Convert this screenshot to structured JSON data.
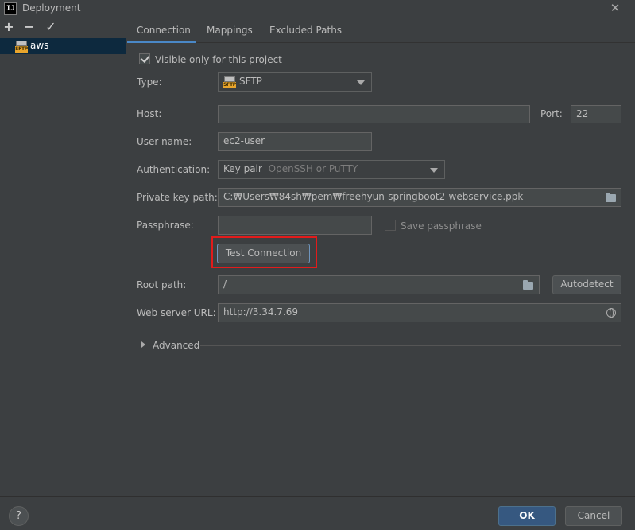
{
  "window": {
    "title": "Deployment",
    "logo_text": "IJ",
    "close_symbol": "✕"
  },
  "toolbar": {
    "add_symbol": "+",
    "remove_symbol": "−",
    "check_symbol": "✓"
  },
  "servers": [
    {
      "name": "aws",
      "icon": "sftp-server-icon",
      "icon_text": "SFTP"
    }
  ],
  "tabs": [
    {
      "label": "Connection",
      "active": true
    },
    {
      "label": "Mappings",
      "active": false
    },
    {
      "label": "Excluded Paths",
      "active": false
    }
  ],
  "form": {
    "visible_only_label": "Visible only for this project",
    "visible_only_checked": true,
    "type_label": "Type:",
    "type_value": "SFTP",
    "type_icon_text": "SFTP",
    "host_label": "Host:",
    "host_value": "",
    "port_label": "Port:",
    "port_value": "22",
    "username_label": "User name:",
    "username_value": "ec2-user",
    "auth_label": "Authentication:",
    "auth_value": "Key pair",
    "auth_hint": "OpenSSH or PuTTY",
    "key_path_label": "Private key path:",
    "key_path_value": "C:₩Users₩84sh₩pem₩freehyun-springboot2-webservice.ppk",
    "passphrase_label": "Passphrase:",
    "passphrase_value": "",
    "save_passphrase_label": "Save passphrase",
    "save_passphrase_checked": false,
    "test_connection_label": "Test Connection",
    "root_path_label": "Root path:",
    "root_path_value": "/",
    "autodetect_label": "Autodetect",
    "web_url_label": "Web server URL:",
    "web_url_value": "http://3.34.7.69",
    "advanced_label": "Advanced"
  },
  "footer": {
    "help_symbol": "?",
    "ok_label": "OK",
    "cancel_label": "Cancel"
  },
  "colors": {
    "background": "#3c3f41",
    "selection": "#0d293e",
    "accent": "#4a88c7",
    "ok_button": "#365880",
    "highlight_border": "#e21b1b"
  }
}
